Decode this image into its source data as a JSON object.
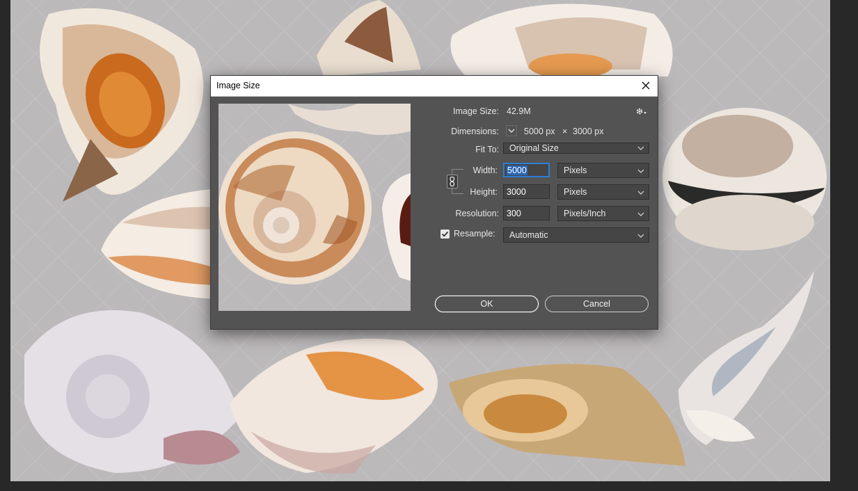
{
  "dialog": {
    "title": "Image Size",
    "image_size_label": "Image Size:",
    "image_size_value": "42.9M",
    "dimensions_label": "Dimensions:",
    "dimensions_width": "5000 px",
    "dimensions_times": "×",
    "dimensions_height": "3000 px",
    "fit_to_label": "Fit To:",
    "fit_to_value": "Original Size",
    "width_label": "Width:",
    "width_value": "5000",
    "width_unit": "Pixels",
    "height_label": "Height:",
    "height_value": "3000",
    "height_unit": "Pixels",
    "resolution_label": "Resolution:",
    "resolution_value": "300",
    "resolution_unit": "Pixels/Inch",
    "resample_label": "Resample:",
    "resample_checked": true,
    "resample_value": "Automatic",
    "ok_label": "OK",
    "cancel_label": "Cancel"
  },
  "icons": {
    "close": "close-icon",
    "settings": "gear-icon",
    "dimensions_toggle": "chevron-down-icon",
    "constrain": "link-icon",
    "checkbox": "checkbox-checked-icon"
  },
  "colors": {
    "canvas": "#bcb9bb",
    "dialog_bg": "#535353",
    "field_bg": "#454545",
    "focus_accent": "#2b7fd4"
  }
}
